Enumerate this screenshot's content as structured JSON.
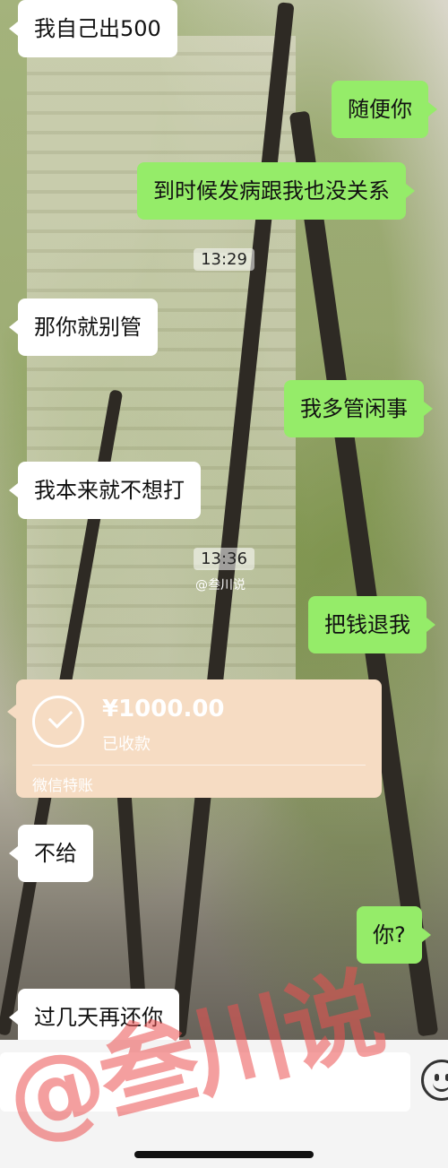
{
  "messages": [
    {
      "side": "in",
      "text": "我自己出500"
    },
    {
      "side": "out",
      "text": "随便你"
    },
    {
      "side": "out",
      "text": "到时候发病跟我也没关系"
    },
    {
      "side": "in",
      "text": "那你就别管"
    },
    {
      "side": "out",
      "text": "我多管闲事"
    },
    {
      "side": "in",
      "text": "我本来就不想打"
    },
    {
      "side": "out",
      "text": "把钱退我"
    },
    {
      "side": "in",
      "text": "不给"
    },
    {
      "side": "out",
      "text": "你?"
    },
    {
      "side": "in",
      "text": "过几天再还你"
    }
  ],
  "times": [
    "13:29",
    "13:36"
  ],
  "transfer": {
    "amount": "¥1000.00",
    "status": "已收款",
    "label": "微信特账",
    "color": "#f6dcc3",
    "icon": "check-circle-icon"
  },
  "watermark": "@叁川说",
  "mini_watermark": "@叁川说",
  "colors": {
    "outgoing": "#95ec69",
    "incoming": "#ffffff"
  }
}
